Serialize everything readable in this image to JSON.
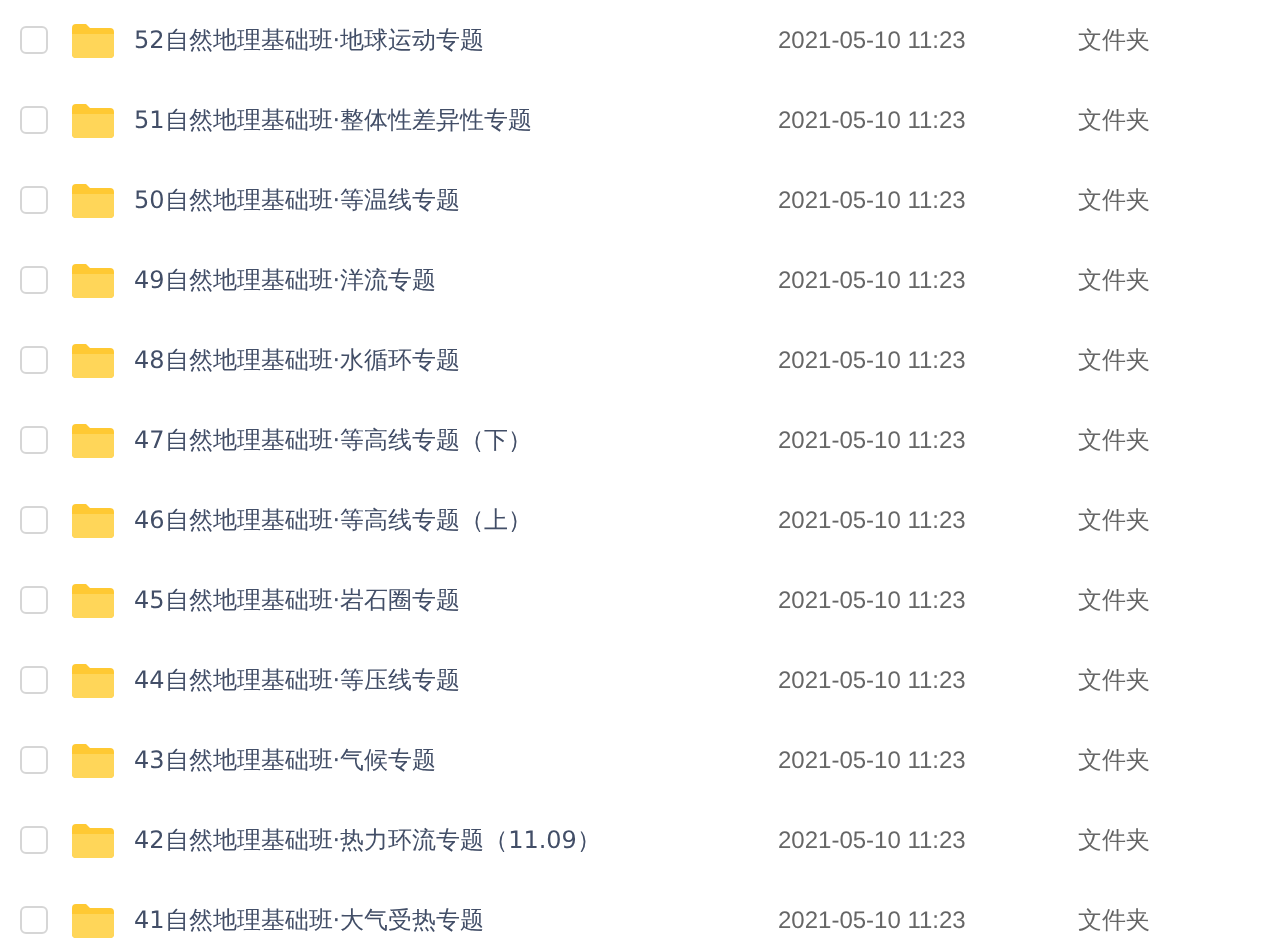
{
  "files": [
    {
      "name": "52自然地理基础班·地球运动专题",
      "modified": "2021-05-10 11:23",
      "type": "文件夹",
      "selected": false
    },
    {
      "name": "51自然地理基础班·整体性差异性专题",
      "modified": "2021-05-10 11:23",
      "type": "文件夹",
      "selected": false
    },
    {
      "name": "50自然地理基础班·等温线专题",
      "modified": "2021-05-10 11:23",
      "type": "文件夹",
      "selected": false
    },
    {
      "name": "49自然地理基础班·洋流专题",
      "modified": "2021-05-10 11:23",
      "type": "文件夹",
      "selected": false
    },
    {
      "name": "48自然地理基础班·水循环专题",
      "modified": "2021-05-10 11:23",
      "type": "文件夹",
      "selected": false
    },
    {
      "name": "47自然地理基础班·等高线专题（下）",
      "modified": "2021-05-10 11:23",
      "type": "文件夹",
      "selected": false
    },
    {
      "name": "46自然地理基础班·等高线专题（上）",
      "modified": "2021-05-10 11:23",
      "type": "文件夹",
      "selected": false
    },
    {
      "name": "45自然地理基础班·岩石圈专题",
      "modified": "2021-05-10 11:23",
      "type": "文件夹",
      "selected": false
    },
    {
      "name": "44自然地理基础班·等压线专题",
      "modified": "2021-05-10 11:23",
      "type": "文件夹",
      "selected": false
    },
    {
      "name": "43自然地理基础班·气候专题",
      "modified": "2021-05-10 11:23",
      "type": "文件夹",
      "selected": false
    },
    {
      "name": "42自然地理基础班·热力环流专题（11.09）",
      "modified": "2021-05-10 11:23",
      "type": "文件夹",
      "selected": false
    },
    {
      "name": "41自然地理基础班·大气受热专题",
      "modified": "2021-05-10 11:23",
      "type": "文件夹",
      "selected": false
    }
  ]
}
